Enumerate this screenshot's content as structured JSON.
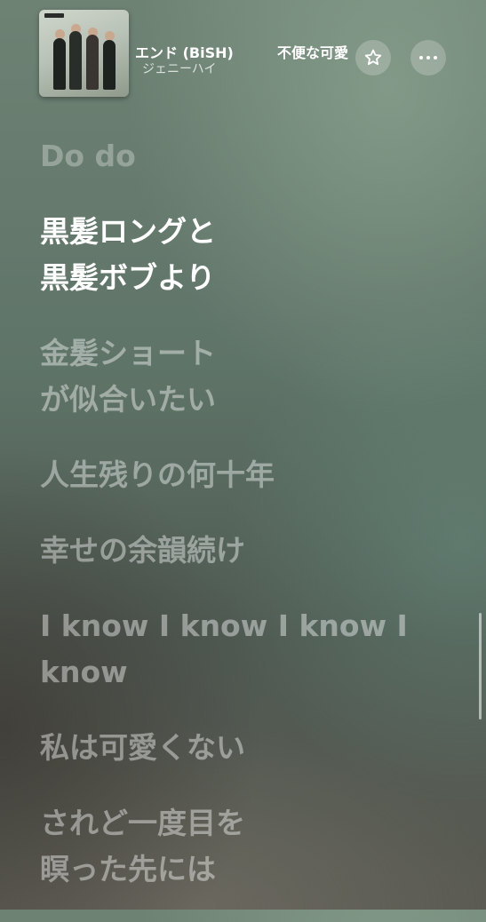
{
  "header": {
    "now_playing_title": "エンド (BiSH)",
    "now_playing_artist": "ジェニーハイ",
    "next_title": "不便な可愛"
  },
  "lyrics": [
    {
      "lines": [
        "Do do"
      ],
      "state": "past"
    },
    {
      "lines": [
        "黒髪ロングと",
        "黒髪ボブより"
      ],
      "state": "current"
    },
    {
      "lines": [
        "金髪ショート",
        "が似合いたい"
      ],
      "state": "upcoming"
    },
    {
      "lines": [
        "人生残りの何十年"
      ],
      "state": "upcoming"
    },
    {
      "lines": [
        "幸せの余韻続け"
      ],
      "state": "upcoming"
    },
    {
      "lines": [
        "I know I know I know I",
        "know"
      ],
      "state": "upcoming"
    },
    {
      "lines": [
        "私は可愛くない"
      ],
      "state": "upcoming"
    },
    {
      "lines": [
        "されど一度目を",
        "瞑った先には"
      ],
      "state": "upcoming"
    }
  ],
  "icons": {
    "favorite": "star-icon",
    "more": "ellipsis-icon"
  }
}
